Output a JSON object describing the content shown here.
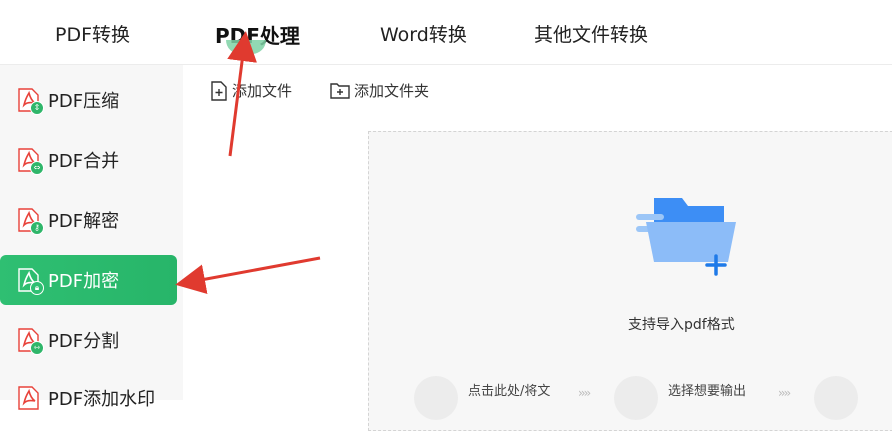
{
  "tabs": [
    {
      "label": "PDF转换",
      "active": false
    },
    {
      "label": "PDF处理",
      "active": true
    },
    {
      "label": "Word转换",
      "active": false
    },
    {
      "label": "其他文件转换",
      "active": false
    }
  ],
  "sidebar": {
    "items": [
      {
        "label": "PDF压缩",
        "badge": "compress",
        "active": false
      },
      {
        "label": "PDF合并",
        "badge": "merge",
        "active": false
      },
      {
        "label": "PDF解密",
        "badge": "unlock",
        "active": false
      },
      {
        "label": "PDF加密",
        "badge": "lock",
        "active": true
      },
      {
        "label": "PDF分割",
        "badge": "split",
        "active": false
      },
      {
        "label": "PDF添加水印",
        "badge": "watermark",
        "active": false
      }
    ]
  },
  "toolbar": {
    "add_file": "添加文件",
    "add_folder": "添加文件夹"
  },
  "dropzone": {
    "support_text": "支持导入pdf格式",
    "step1": "点击此处/将文",
    "step2": "选择想要输出"
  },
  "colors": {
    "accent": "#2fbf72",
    "pdf_red": "#e8423a",
    "folder_blue": "#3d8ef5",
    "annotation_red": "#e03a2f"
  }
}
